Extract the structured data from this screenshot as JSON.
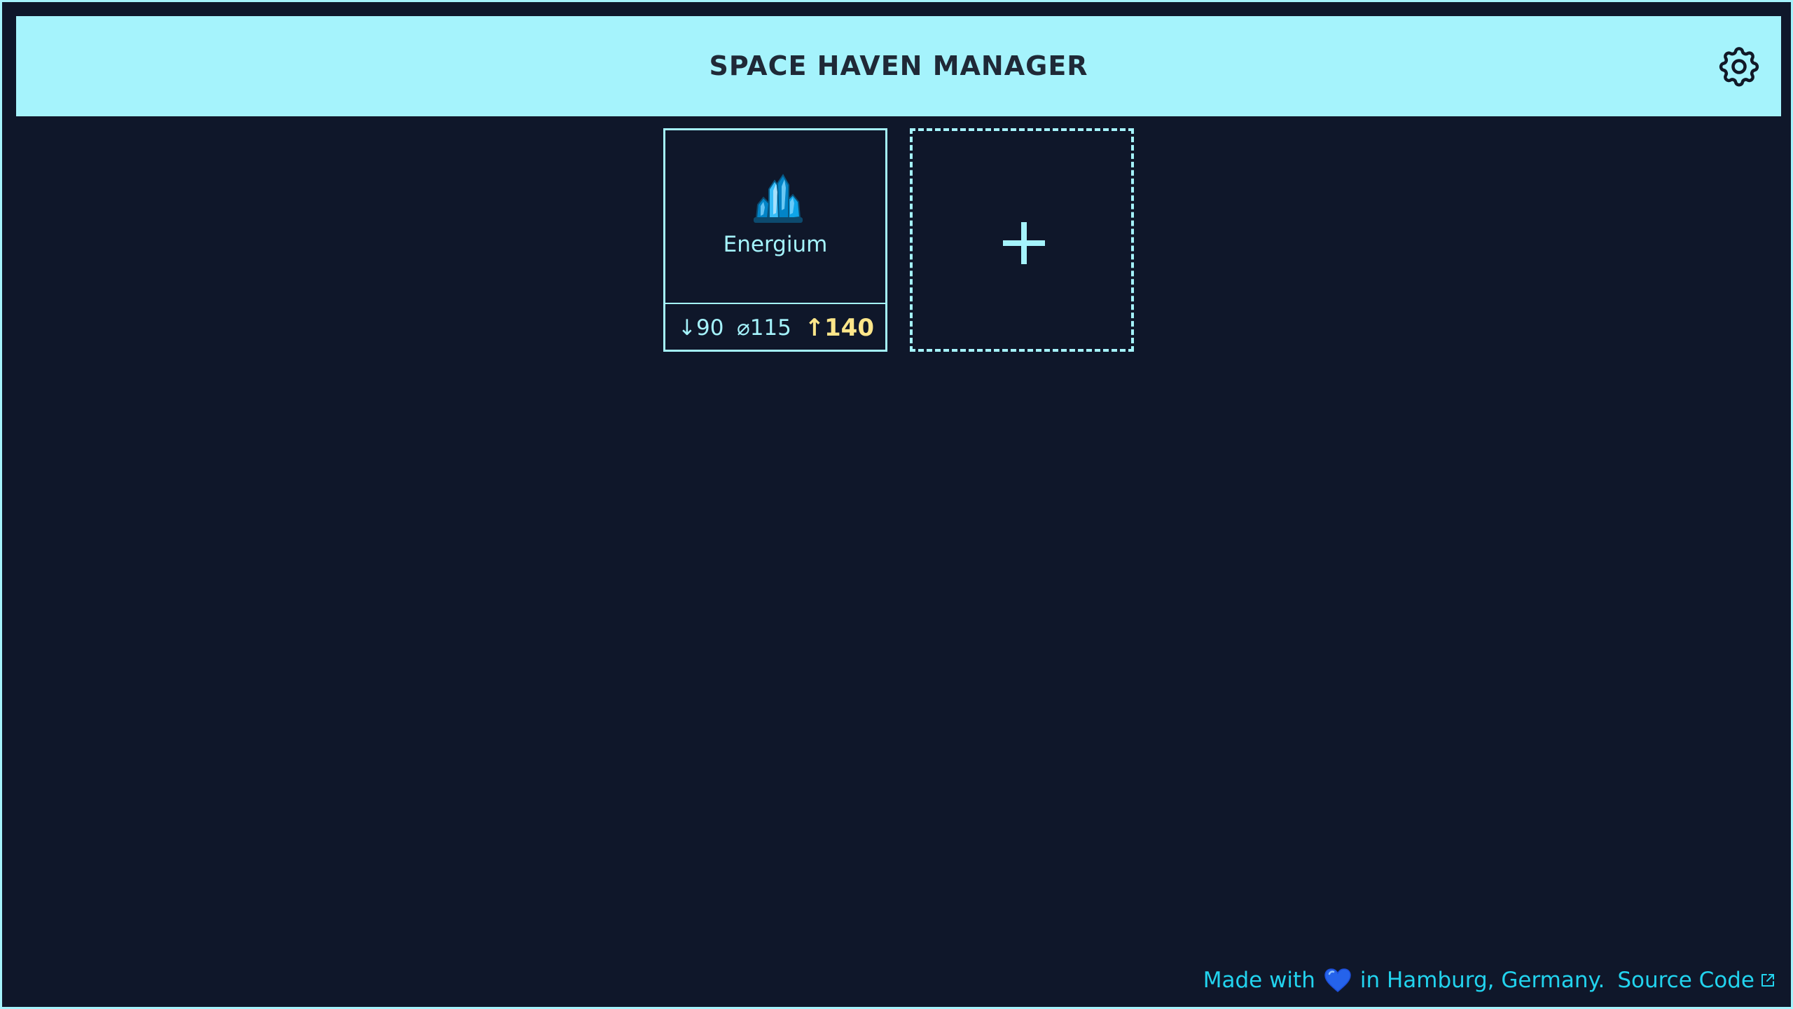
{
  "header": {
    "title": "SPACE HAVEN MANAGER",
    "settings_icon": "gear-icon"
  },
  "items": [
    {
      "name": "Energium",
      "icon": "energium-crystal-icon",
      "stats": {
        "min": "↓90",
        "avg": "⌀115",
        "max": "↑140"
      }
    }
  ],
  "add_item": {
    "icon": "plus-icon"
  },
  "footer": {
    "made_with": "Made with",
    "heart_icon": "blue-heart-icon",
    "location": "in Hamburg, Germany.",
    "source_link": "Source Code",
    "external_icon": "external-link-icon"
  },
  "colors": {
    "background": "#0f172a",
    "accent": "#a5f3fc",
    "highlight": "#fde68a",
    "link": "#22d3ee",
    "header_text": "#1f2937"
  }
}
